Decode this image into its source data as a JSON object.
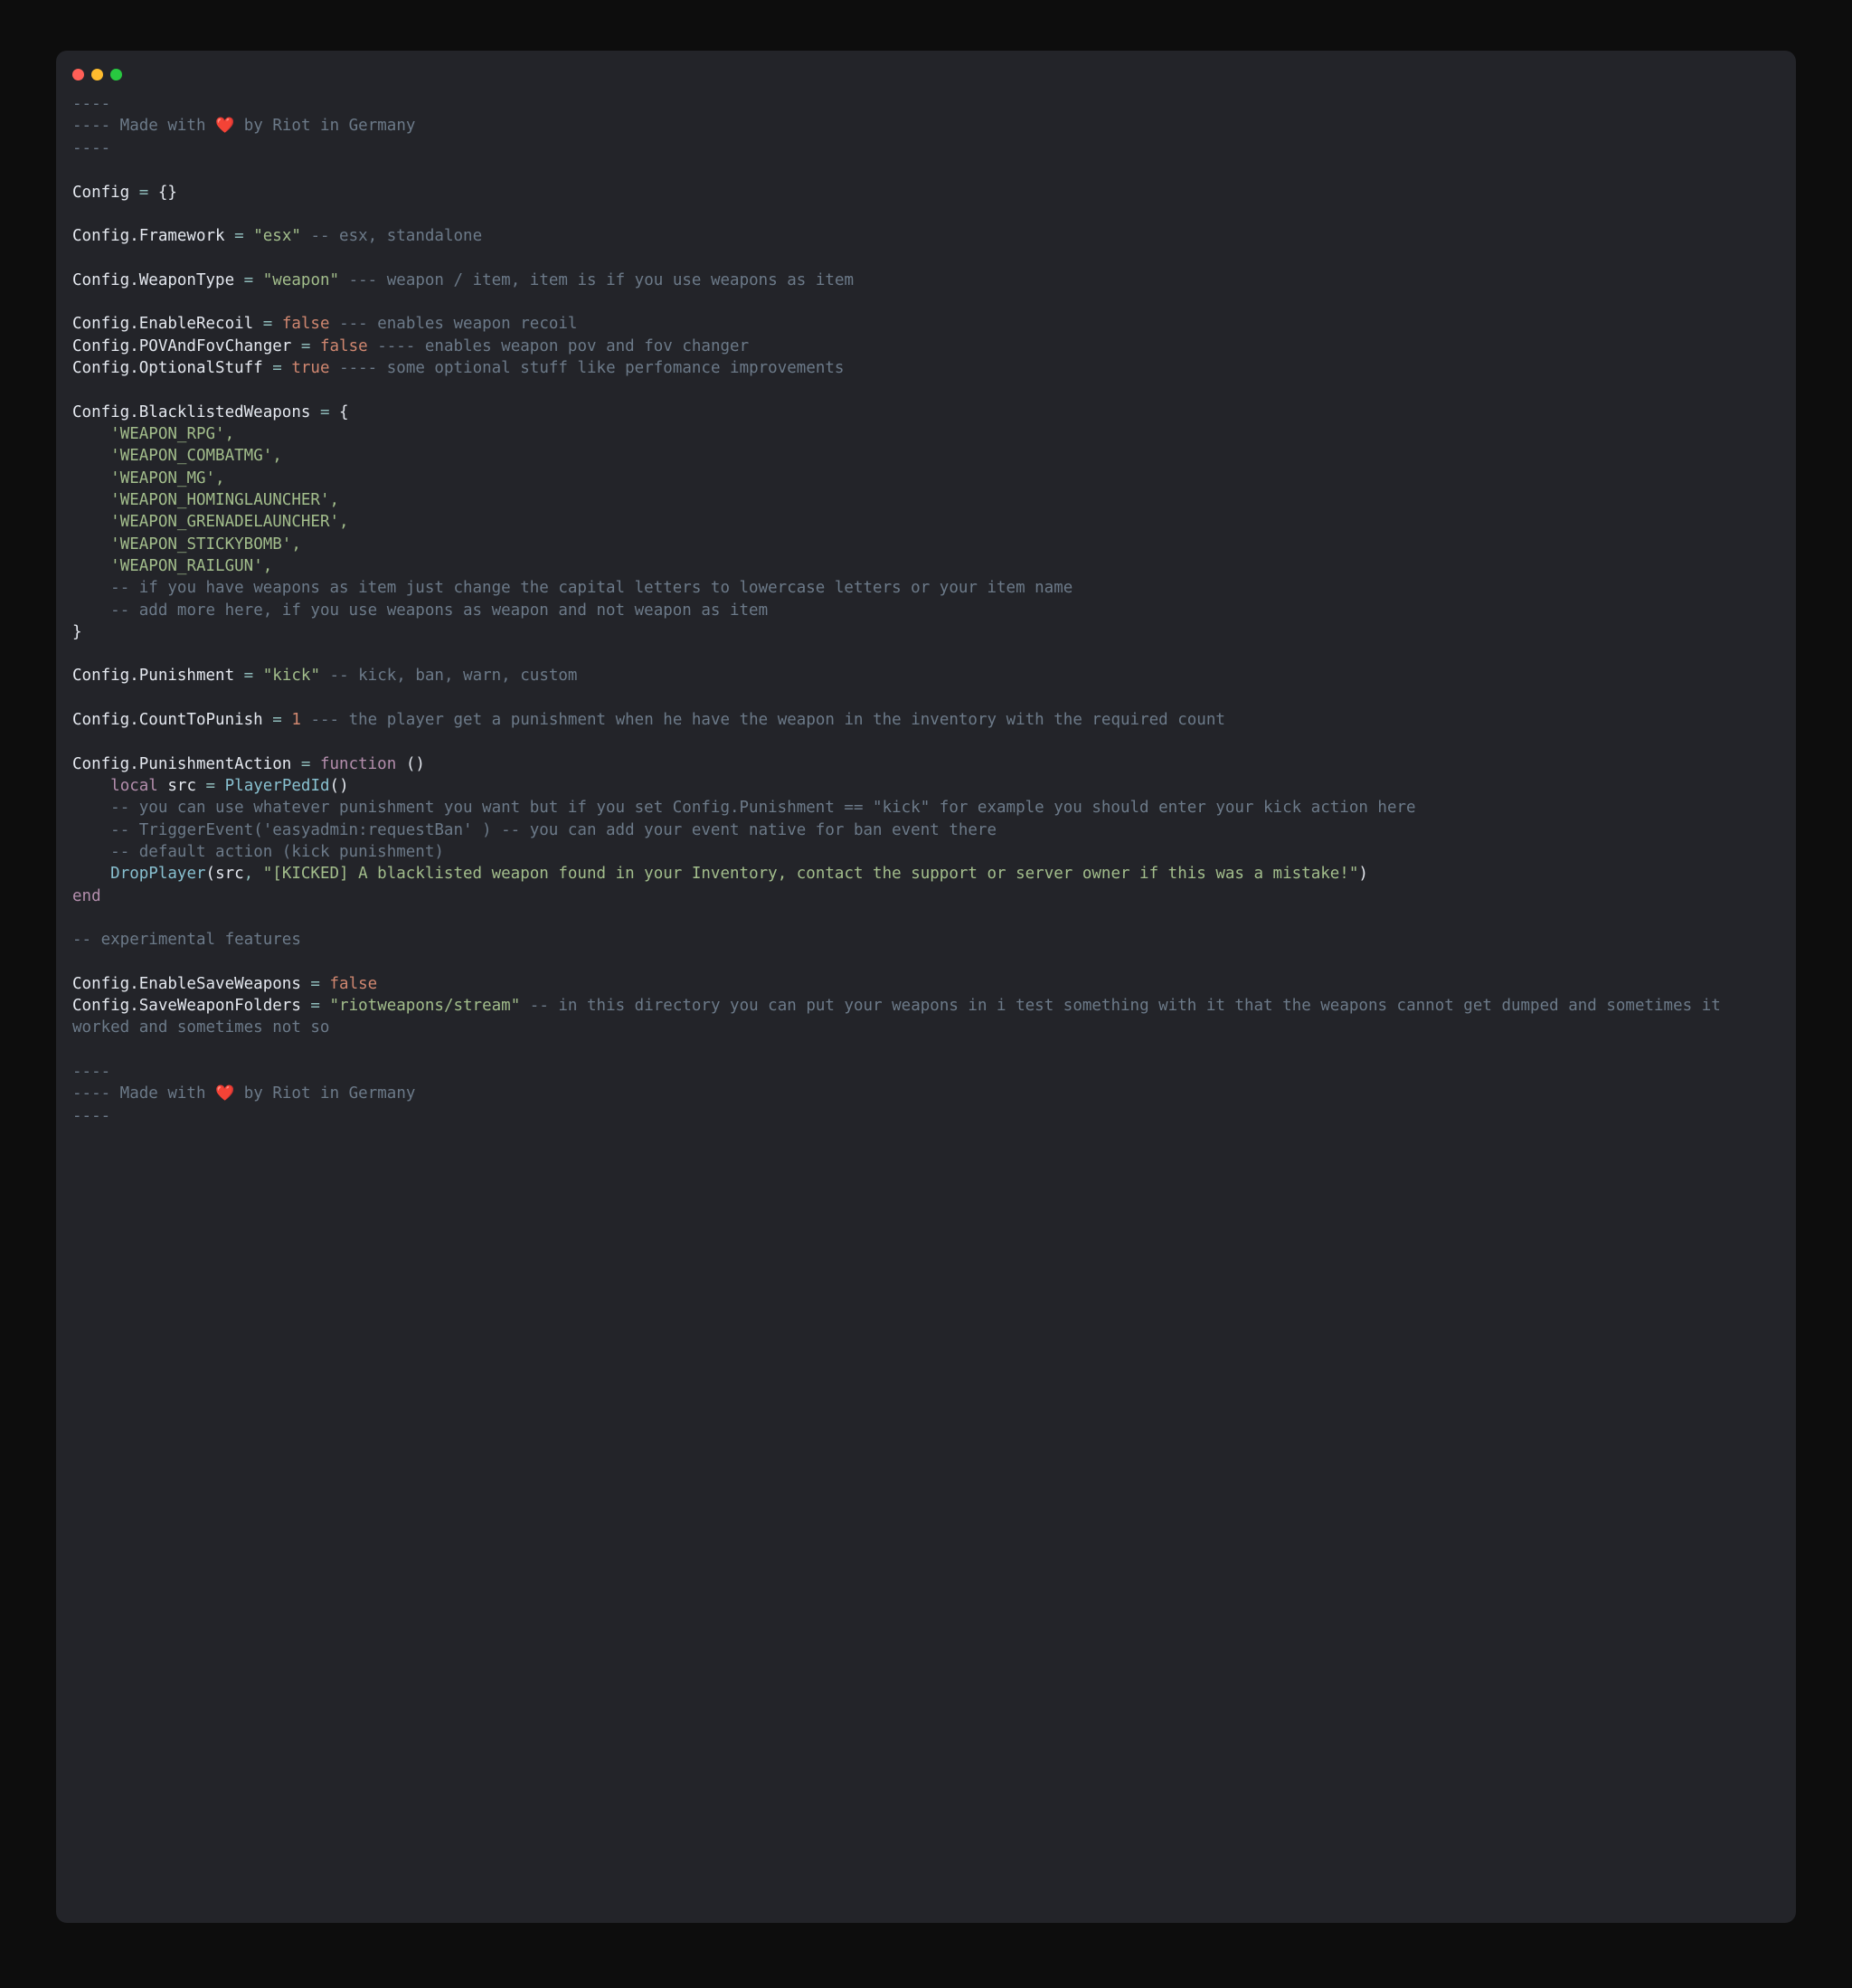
{
  "header": {
    "prefix": "---- Made with ",
    "heart": "❤️",
    "suffix": " by Riot in Germany"
  },
  "footer": {
    "prefix": "---- Made with ",
    "heart": "❤️",
    "suffix": " by Riot in Germany"
  },
  "dashes": "----",
  "cfg": {
    "decl": "Config",
    "eq": "=",
    "braces_open": "{}",
    "framework": {
      "key": "Config.Framework",
      "val": "\"esx\"",
      "cmt": "-- esx, standalone"
    },
    "weapontype": {
      "key": "Config.WeaponType",
      "val": "\"weapon\"",
      "cmt": "--- weapon / item, item is if you use weapons as item"
    },
    "enableRecoil": {
      "key": "Config.EnableRecoil",
      "val": "false",
      "cmt": "--- enables weapon recoil"
    },
    "povfov": {
      "key": "Config.POVAndFovChanger",
      "val": "false",
      "cmt": "---- enables weapon pov and fov changer"
    },
    "optional": {
      "key": "Config.OptionalStuff",
      "val": "true",
      "cmt": "---- some optional stuff like perfomance improvements"
    },
    "blacklist": {
      "key": "Config.BlacklistedWeapons"
    },
    "bl_items": [
      "'WEAPON_RPG',",
      "'WEAPON_COMBATMG',",
      "'WEAPON_MG',",
      "'WEAPON_HOMINGLAUNCHER',",
      "'WEAPON_GRENADELAUNCHER',",
      "'WEAPON_STICKYBOMB',",
      "'WEAPON_RAILGUN',"
    ],
    "bl_cmt1": "-- if you have weapons as item just change the capital letters to lowercase letters or your item name",
    "bl_cmt2": "-- add more here, if you use weapons as weapon and not weapon as item",
    "punishment": {
      "key": "Config.Punishment",
      "val": "\"kick\"",
      "cmt": "-- kick, ban, warn, custom"
    },
    "countToPunish": {
      "key": "Config.CountToPunish",
      "val": "1",
      "cmt": "--- the player get a punishment when he have the weapon in the inventory with the required count"
    },
    "punAction": {
      "key": "Config.PunishmentAction",
      "kw_function": "function",
      "paren": "()"
    },
    "local_kw": "local",
    "src_ident": "src",
    "playerPed": "PlayerPedId",
    "fn_cmt1": "-- you can use whatever punishment you want but if you set Config.Punishment == \"kick\" for example you should enter your kick action here",
    "fn_cmt2": "-- TriggerEvent('easyadmin:requestBan' ) -- you can add your event native for ban event there",
    "fn_cmt3": "-- default action (kick punishment)",
    "drop": {
      "fn": "DropPlayer",
      "arg1": "src",
      "arg2": "\"[KICKED] A blacklisted weapon found in your Inventory, contact the support or server owner if this was a mistake!\"",
      "close": ")"
    },
    "end_kw": "end",
    "exp_cmt": "-- experimental features",
    "enableSave": {
      "key": "Config.EnableSaveWeapons",
      "val": "false"
    },
    "saveFolders": {
      "key": "Config.SaveWeaponFolders",
      "val": "\"riotweapons/stream\"",
      "cmt": "-- in this directory you can put your weapons in i test something with it that the weapons cannot get dumped and sometimes it worked and sometimes not so"
    }
  }
}
